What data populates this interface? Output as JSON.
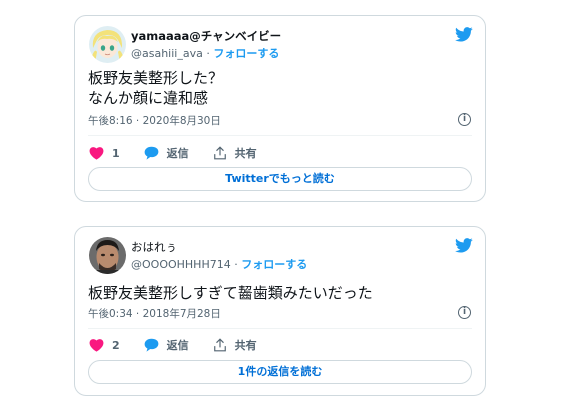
{
  "colors": {
    "accent": "#1d9bf0",
    "heart": "#f91880",
    "muted": "#536471",
    "border": "#cfd9de"
  },
  "tweets": [
    {
      "display_name": "yamaaaa@チャンベイビー",
      "handle": "@asahiii_ava",
      "separator": "·",
      "follow_label": "フォローする",
      "text_lines": [
        "板野友美整形した？",
        "なんか顔に違和感"
      ],
      "timestamp": "午後8:16 · 2020年8月30日",
      "like_count": "1",
      "reply_label": "返信",
      "share_label": "共有",
      "read_button": "Twitterでもっと読む",
      "avatar_icon": "anime-girl-avatar",
      "logo_icon": "twitter-bird-icon"
    },
    {
      "display_name": "おはれぅ",
      "handle": "@OOOOHHHH714",
      "separator": "·",
      "follow_label": "フォローする",
      "text_lines": [
        "板野友美整形しすぎて齧歯類みたいだった"
      ],
      "timestamp": "午後0:34 · 2018年7月28日",
      "like_count": "2",
      "reply_label": "返信",
      "share_label": "共有",
      "read_button": "1件の返信を読む",
      "avatar_icon": "man-photo-avatar",
      "logo_icon": "twitter-bird-icon"
    }
  ]
}
